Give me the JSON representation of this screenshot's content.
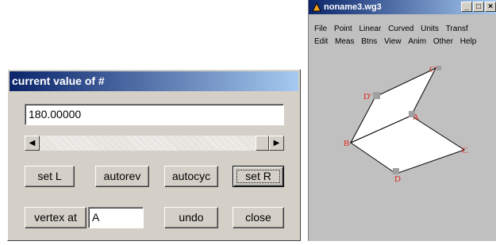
{
  "app": {
    "title": "noname3.wg3",
    "menu_row1": [
      "File",
      "Point",
      "Linear",
      "Curved",
      "Units",
      "Transf"
    ],
    "menu_row2": [
      "Edit",
      "Meas",
      "Btns",
      "View",
      "Anim",
      "Other",
      "Help"
    ],
    "title_buttons": [
      "_",
      "□",
      "×"
    ],
    "canvas": {
      "point_labels": [
        "C'",
        "D'",
        "A",
        "B",
        "C",
        "D"
      ],
      "colors": {
        "canvas": "#c0c0c0",
        "shape": "#ffffff",
        "label": "#e0261c",
        "marker": "#a0a0a0"
      }
    }
  },
  "dialog": {
    "title": "current value of #",
    "value": "180.00000",
    "slider_position": 1.0,
    "buttons": {
      "set_l": "set L",
      "autorev": "autorev",
      "autocyc": "autocyc",
      "set_r": "set R",
      "vertex_at": "vertex at",
      "undo": "undo",
      "close": "close"
    },
    "vertex_value": "A"
  },
  "colors": {
    "titlebar_start": "#0a246a",
    "titlebar_end": "#a6caf0",
    "face": "#d4d0c8"
  }
}
